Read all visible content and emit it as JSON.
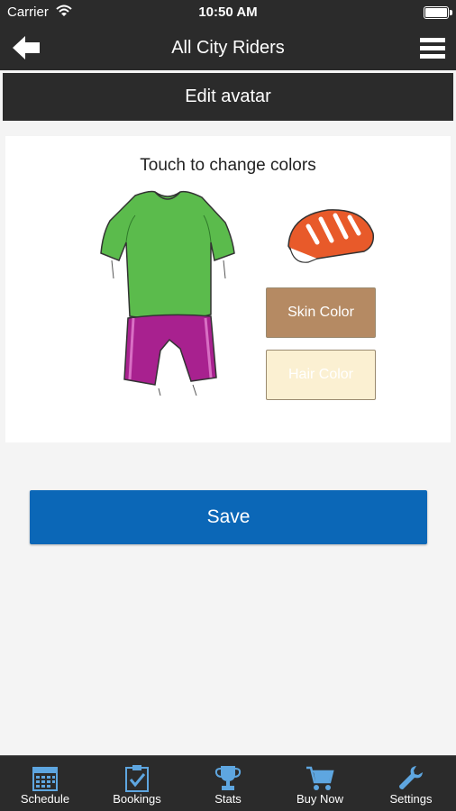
{
  "status_bar": {
    "carrier": "Carrier",
    "time": "10:50 AM"
  },
  "nav": {
    "title": "All City Riders",
    "back_icon": "back-arrow-icon",
    "menu_icon": "hamburger-menu-icon"
  },
  "section": {
    "title": "Edit avatar"
  },
  "avatar_editor": {
    "hint": "Touch to change colors",
    "shirt_color": "#5bbb4c",
    "shorts_color": "#a8218f",
    "helmet_color": "#e85a2a",
    "skin_button": {
      "label": "Skin Color",
      "color": "#b58a63"
    },
    "hair_button": {
      "label": "Hair Color",
      "color": "#fbf0d2"
    }
  },
  "save_button": {
    "label": "Save",
    "color": "#0b67b7"
  },
  "tab_bar": {
    "tabs": [
      {
        "label": "Schedule",
        "icon": "calendar-icon"
      },
      {
        "label": "Bookings",
        "icon": "clipboard-check-icon"
      },
      {
        "label": "Stats",
        "icon": "trophy-icon"
      },
      {
        "label": "Buy Now",
        "icon": "cart-icon"
      },
      {
        "label": "Settings",
        "icon": "wrench-icon"
      }
    ],
    "icon_color": "#5ea6e0"
  }
}
